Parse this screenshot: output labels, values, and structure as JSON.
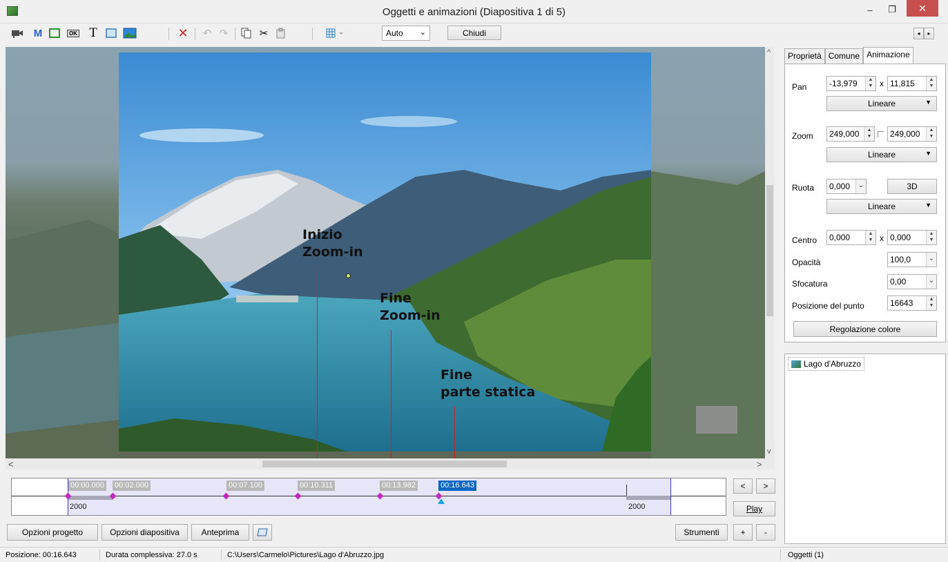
{
  "window": {
    "title": "Oggetti e animazioni  (Diapositiva 1 di 5)",
    "minimize_label": "–",
    "maximize_label": "❐",
    "close_label": "✕"
  },
  "toolbar": {
    "icons": [
      "camera-icon",
      "m-text-icon",
      "frame-icon",
      "button-icon",
      "text-icon",
      "rectangle-icon",
      "image-icon",
      "delete-icon",
      "undo-icon",
      "redo-icon",
      "copy-icon",
      "cut-icon",
      "paste-icon",
      "grid-icon"
    ],
    "m_label": "M",
    "t_label": "T",
    "ok_label": "OK",
    "delete_glyph": "✕",
    "zoom_combo": "Auto",
    "close_button": "Chiudi"
  },
  "canvas": {
    "annotations": [
      {
        "line1": "Inizio",
        "line2": "Zoom-in"
      },
      {
        "line1": "Fine",
        "line2": "Zoom-in"
      },
      {
        "line1": "Fine",
        "line2": "parte statica"
      }
    ]
  },
  "timeline": {
    "keyframes": [
      "00:00.000",
      "00:02.000",
      "00:07.100",
      "00:10.311",
      "00:13.982",
      "00:16.643"
    ],
    "active_keyframe": "00:16.643",
    "left_value": "2000",
    "right_value": "2000",
    "prev_button": "<",
    "next_button": ">",
    "play_button": "Play"
  },
  "bottom_buttons": {
    "project_options": "Opzioni progetto",
    "slide_options": "Opzioni diapositiva",
    "preview": "Anteprima",
    "tools": "Strumenti",
    "plus": "+",
    "minus": "-"
  },
  "panel": {
    "tabs": [
      "Proprietà",
      "Comune",
      "Animazione"
    ],
    "active_tab": "Animazione",
    "pan_label": "Pan",
    "pan_x": "-13,979",
    "pan_y": "11,815",
    "pan_interp": "Lineare",
    "zoom_label": "Zoom",
    "zoom_x": "249,000",
    "zoom_y": "249,000",
    "zoom_interp": "Lineare",
    "rotate_label": "Ruota",
    "rotate_value": "0,000",
    "rotate_3d": "3D",
    "rotate_interp": "Lineare",
    "center_label": "Centro",
    "center_x": "0,000",
    "center_y": "0,000",
    "x_sep": "x",
    "opacity_label": "Opacità",
    "opacity_value": "100,0",
    "blur_label": "Sfocatura",
    "blur_value": "0,00",
    "point_pos_label": "Posizione del punto",
    "point_pos_value": "16643",
    "color_adjust": "Regolazione colore",
    "objects": [
      "Lago d'Abruzzo"
    ]
  },
  "status": {
    "position": "Posizione: 00:16.643",
    "duration": "Durata complessiva: 27.0 s",
    "path": "C:\\Users\\Carmelo\\Pictures\\Lago d'Abruzzo.jpg",
    "objects_count": "Oggetti (1)"
  }
}
